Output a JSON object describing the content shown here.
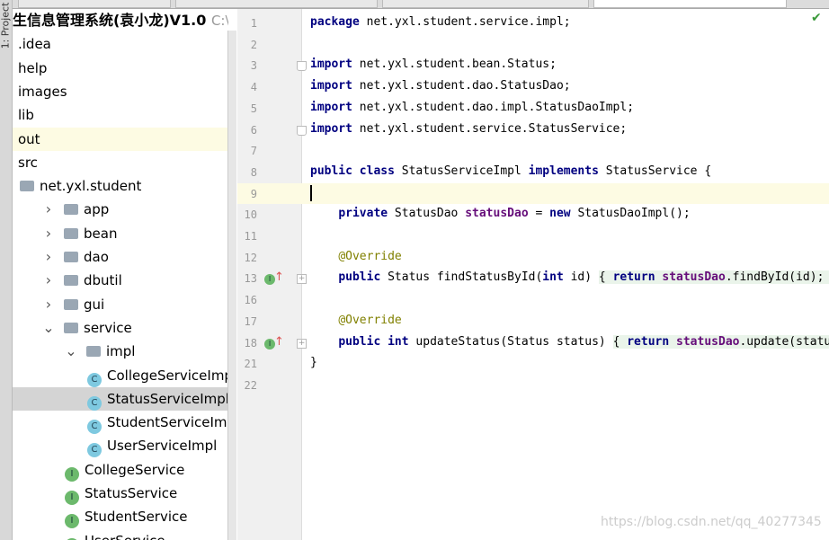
{
  "left_tool_window": "1: Project",
  "project": {
    "title": "生信息管理系统(袁小龙)V1.0",
    "path": "C:\\User",
    "items": [
      {
        "label": ".idea",
        "indent": 0,
        "type": "plain"
      },
      {
        "label": "help",
        "indent": 0,
        "type": "plain"
      },
      {
        "label": "images",
        "indent": 0,
        "type": "plain"
      },
      {
        "label": "lib",
        "indent": 0,
        "type": "plain"
      },
      {
        "label": "out",
        "indent": 0,
        "type": "plain",
        "state": "highlight"
      },
      {
        "label": "src",
        "indent": 0,
        "type": "plain"
      },
      {
        "label": "net.yxl.student",
        "indent": 0,
        "type": "package"
      },
      {
        "label": "app",
        "indent": 1,
        "type": "package",
        "arrow": "right"
      },
      {
        "label": "bean",
        "indent": 1,
        "type": "package",
        "arrow": "right"
      },
      {
        "label": "dao",
        "indent": 1,
        "type": "package",
        "arrow": "right"
      },
      {
        "label": "dbutil",
        "indent": 1,
        "type": "package",
        "arrow": "right"
      },
      {
        "label": "gui",
        "indent": 1,
        "type": "package",
        "arrow": "right"
      },
      {
        "label": "service",
        "indent": 1,
        "type": "package",
        "arrow": "down"
      },
      {
        "label": "impl",
        "indent": 2,
        "type": "package",
        "arrow": "down"
      },
      {
        "label": "CollegeServiceImpl",
        "indent": 3,
        "type": "class"
      },
      {
        "label": "StatusServiceImpl",
        "indent": 3,
        "type": "class",
        "state": "selected"
      },
      {
        "label": "StudentServiceImpl",
        "indent": 3,
        "type": "class"
      },
      {
        "label": "UserServiceImpl",
        "indent": 3,
        "type": "class"
      },
      {
        "label": "CollegeService",
        "indent": 2,
        "type": "interface"
      },
      {
        "label": "StatusService",
        "indent": 2,
        "type": "interface"
      },
      {
        "label": "StudentService",
        "indent": 2,
        "type": "interface"
      },
      {
        "label": "UserService",
        "indent": 2,
        "type": "interface"
      }
    ]
  },
  "editor": {
    "lines": [
      {
        "n": "1",
        "html": "<span class='kw'>package</span> net.yxl.student.service.impl;"
      },
      {
        "n": "2",
        "html": ""
      },
      {
        "n": "3",
        "html": "<span class='kw'>import</span> net.yxl.student.bean.Status;"
      },
      {
        "n": "4",
        "html": "<span class='kw'>import</span> net.yxl.student.dao.StatusDao;"
      },
      {
        "n": "5",
        "html": "<span class='kw'>import</span> net.yxl.student.dao.impl.StatusDaoImpl;"
      },
      {
        "n": "6",
        "html": "<span class='kw'>import</span> net.yxl.student.service.StatusService;"
      },
      {
        "n": "7",
        "html": ""
      },
      {
        "n": "8",
        "html": "<span class='kw'>public class</span> StatusServiceImpl <span class='kw'>implements</span> StatusService {"
      },
      {
        "n": "9",
        "html": ""
      },
      {
        "n": "10",
        "html": "    <span class='kw'>private</span> StatusDao <span class='fld'>statusDao</span> = <span class='kw'>new</span> StatusDaoImpl();"
      },
      {
        "n": "11",
        "html": ""
      },
      {
        "n": "12",
        "html": "    <span class='ann'>@Override</span>"
      },
      {
        "n": "13",
        "html": "    <span class='kw'>public</span> Status findStatusById(<span class='kw'>int</span> id) <span class='folded'>{ <span class='kw'>return</span> <span class='fld'>statusDao</span>.findById(id); }</span>"
      },
      {
        "n": "16",
        "html": ""
      },
      {
        "n": "17",
        "html": "    <span class='ann'>@Override</span>"
      },
      {
        "n": "18",
        "html": "    <span class='kw'>public int</span> updateStatus(Status status) <span class='folded'>{ <span class='kw'>return</span> <span class='fld'>statusDao</span>.update(status); }</span>"
      },
      {
        "n": "21",
        "html": "}"
      },
      {
        "n": "22",
        "html": ""
      }
    ]
  },
  "watermark": "https://blog.csdn.net/qq_40277345"
}
